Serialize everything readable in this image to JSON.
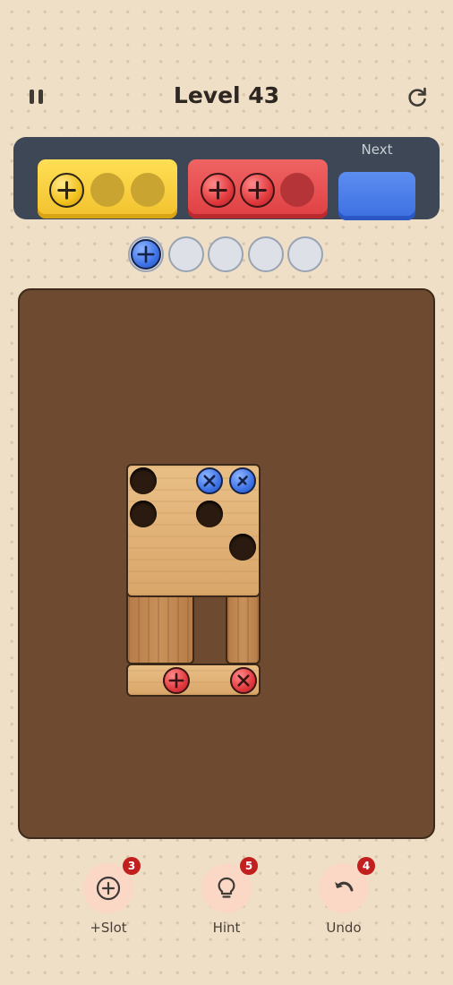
{
  "header": {
    "title": "Level 43",
    "pause_icon": "pause-icon",
    "restart_icon": "restart-icon"
  },
  "box_bar": {
    "next_label": "Next",
    "boxes": [
      {
        "color": "yellow",
        "screws_filled": 1,
        "slots": 3
      },
      {
        "color": "red",
        "screws_filled": 2,
        "slots": 3
      }
    ],
    "next_box_color": "blue"
  },
  "holding_slots": {
    "total": 5,
    "filled": [
      {
        "color": "blue"
      }
    ]
  },
  "board": {
    "planks": [
      {
        "id": "top-plank",
        "screws": [
          "blue",
          "blue"
        ],
        "empty_holes": 4
      },
      {
        "id": "bottom-plank",
        "screws": [
          "red",
          "red"
        ]
      },
      {
        "id": "left-post",
        "screws": []
      },
      {
        "id": "right-post",
        "screws": []
      }
    ]
  },
  "toolbar": {
    "add_slot": {
      "label": "+Slot",
      "count": "3",
      "icon": "plus-circle-icon"
    },
    "hint": {
      "label": "Hint",
      "count": "5",
      "icon": "lightbulb-icon"
    },
    "undo": {
      "label": "Undo",
      "count": "4",
      "icon": "undo-icon"
    }
  },
  "colors": {
    "background": "#efdfc6",
    "box_bar": "#3d4756",
    "yellow": "#f2c12d",
    "red": "#df3f42",
    "blue": "#3c6fe1",
    "board": "#6e4b30",
    "badge": "#c21f1f"
  }
}
